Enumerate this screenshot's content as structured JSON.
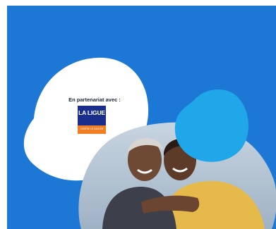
{
  "partner": {
    "label": "En partenariat avec :",
    "logo_title": "LA LIGUE",
    "logo_subtitle": "CONTRE LE CANCER"
  },
  "photo": {
    "subject": "two smiling women embracing"
  },
  "colors": {
    "background_blue": "#1c78d4",
    "accent_cyan": "#1fa7ea",
    "white_blob": "#ffffff",
    "logo_navy": "#1a2f8c",
    "logo_orange": "#f07e22"
  },
  "icons": {
    "partner_logo": "la-ligue-logo-icon"
  }
}
